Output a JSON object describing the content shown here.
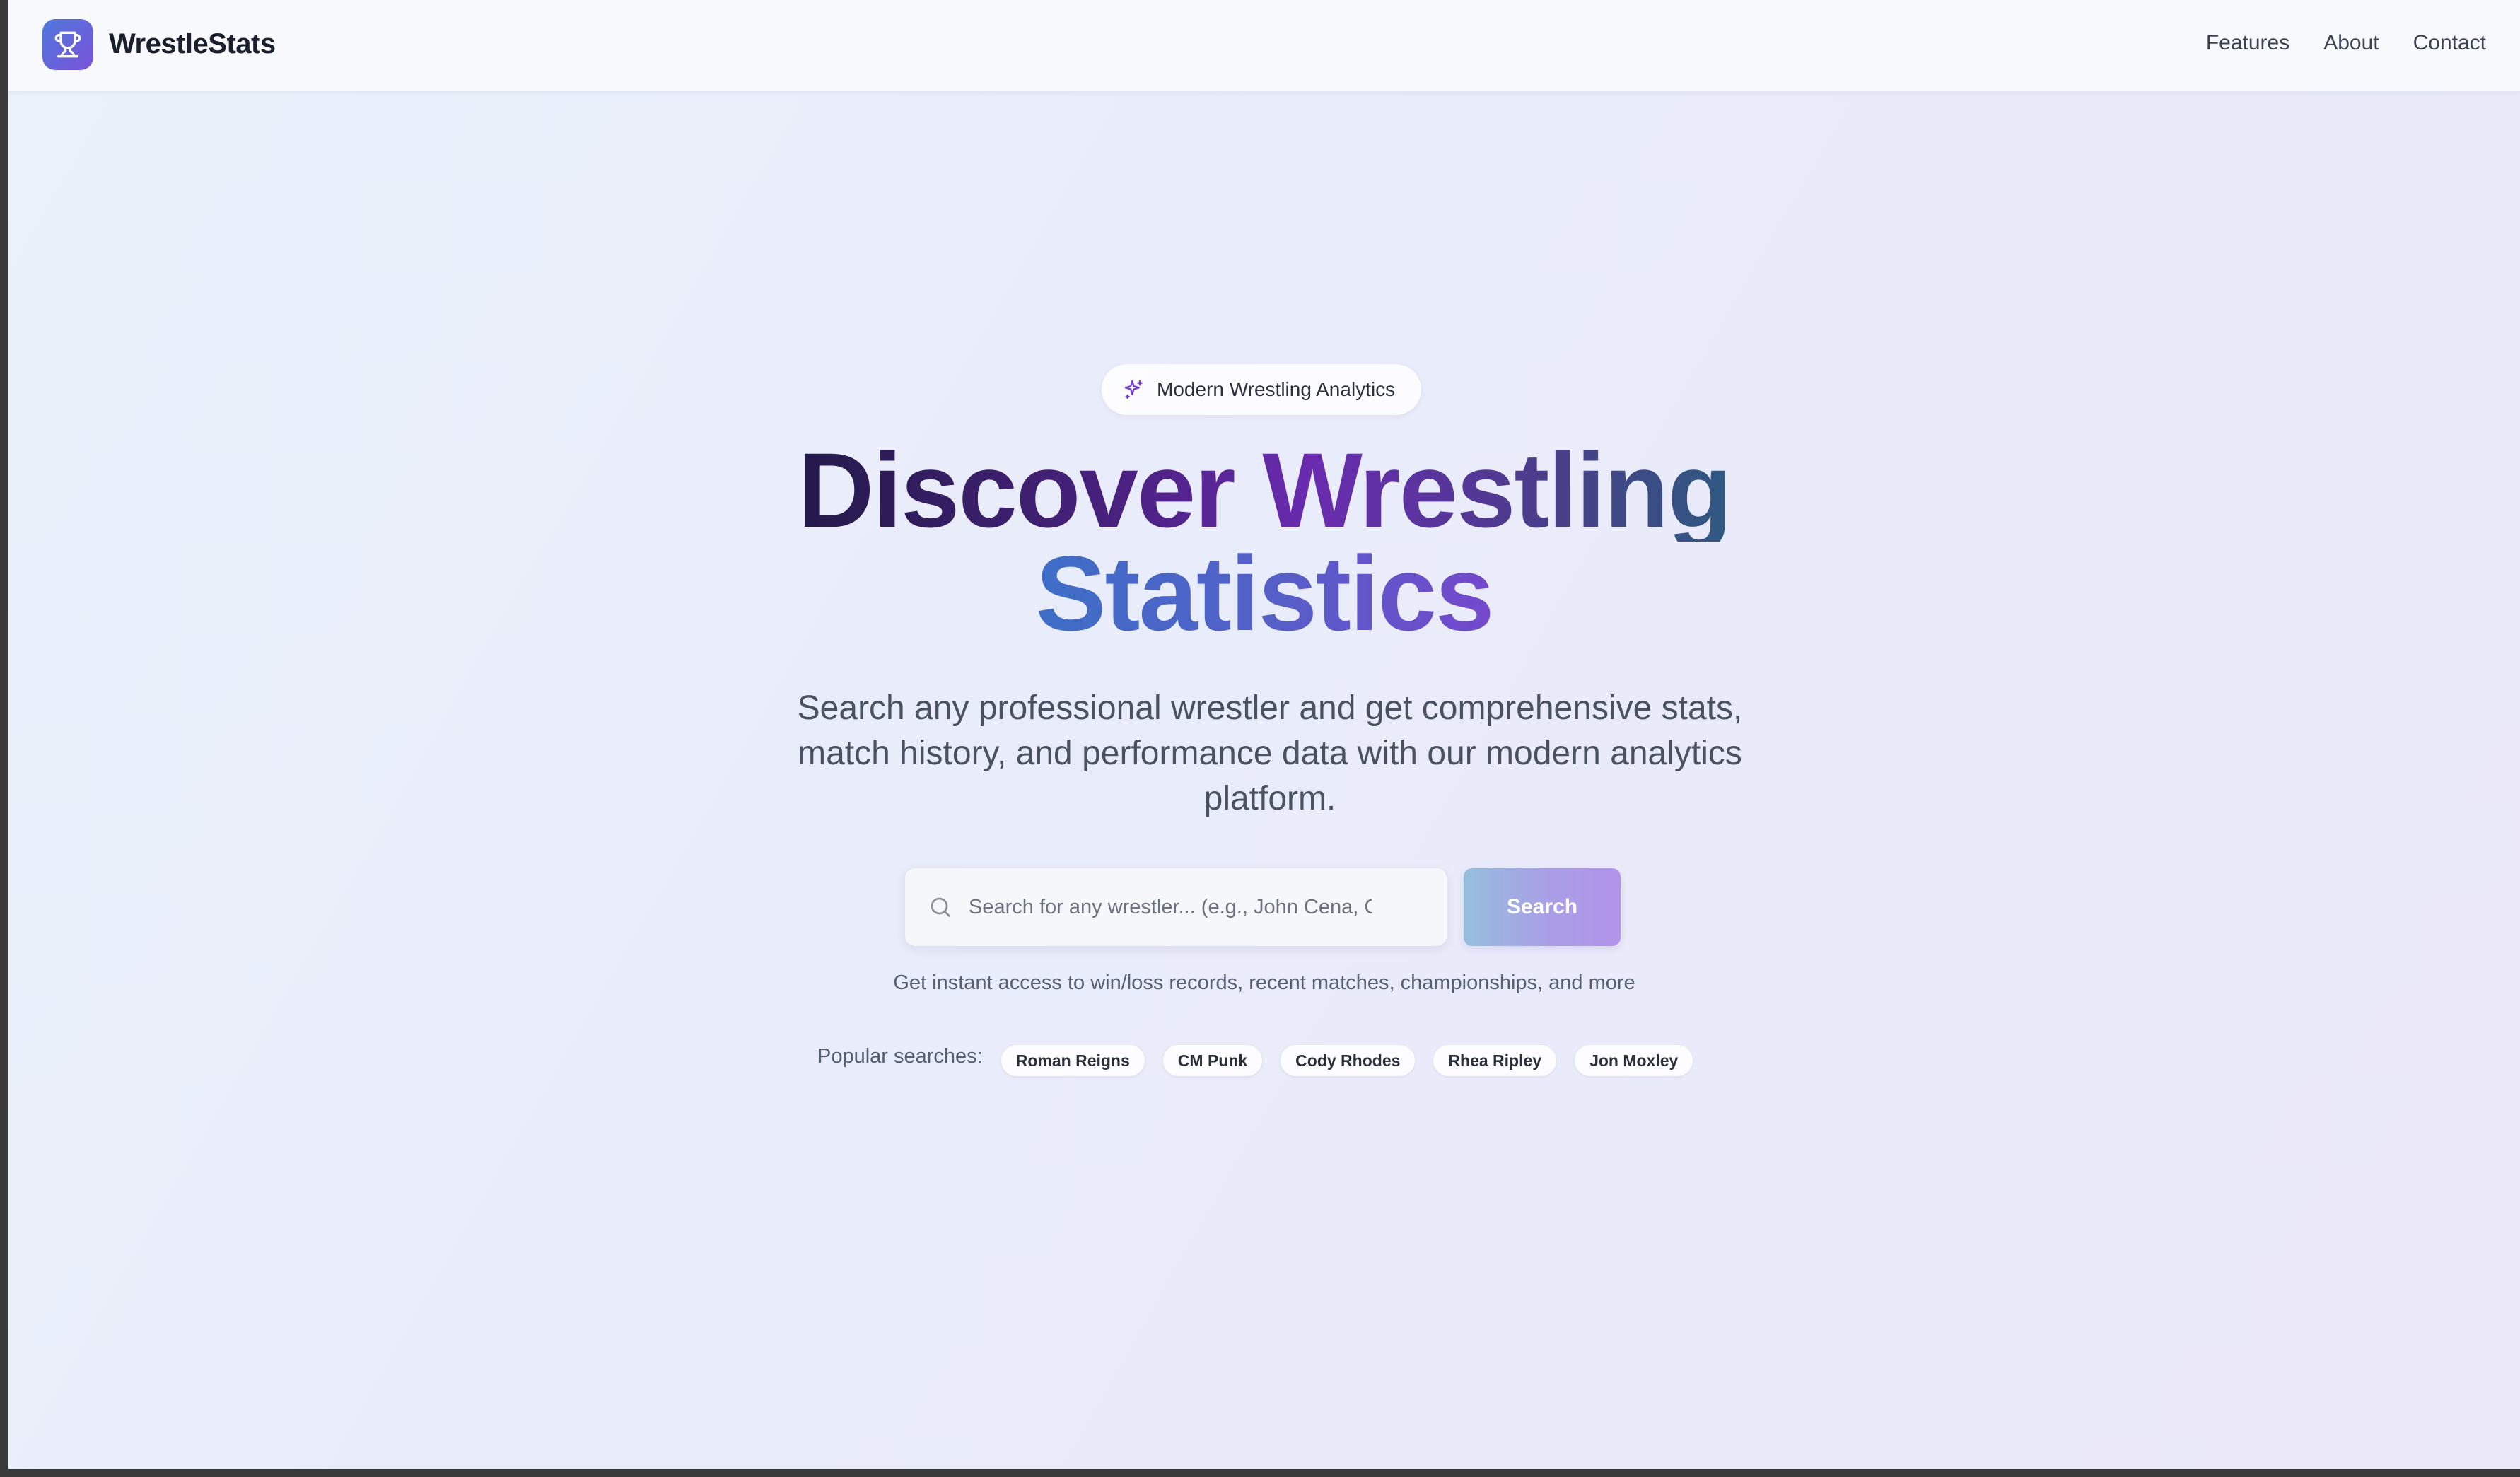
{
  "header": {
    "brand": "WrestleStats",
    "logo_icon": "trophy-icon",
    "nav": [
      {
        "label": "Features"
      },
      {
        "label": "About"
      },
      {
        "label": "Contact"
      }
    ]
  },
  "hero": {
    "badge": {
      "icon": "sparkles-icon",
      "text": "Modern Wrestling Analytics"
    },
    "title_line1": "Discover Wrestling",
    "title_line2": "Statistics",
    "subtitle": "Search any professional wrestler and get comprehensive stats, match history, and performance data with our modern analytics platform.",
    "search": {
      "icon": "search-icon",
      "placeholder": "Search for any wrestler... (e.g., John Cena, CM",
      "value": "",
      "button_label": "Search"
    },
    "helper_text": "Get instant access to win/loss records, recent matches, championships, and more",
    "popular_label": "Popular searches:",
    "popular": [
      "Roman Reigns",
      "CM Punk",
      "Cody Rhodes",
      "Rhea Ripley",
      "Jon Moxley"
    ]
  },
  "colors": {
    "brand_gradient_start": "#4f78dc",
    "brand_gradient_end": "#7a52d9",
    "accent_purple": "#6a2bb0",
    "text_dark": "#1a1f2e"
  }
}
